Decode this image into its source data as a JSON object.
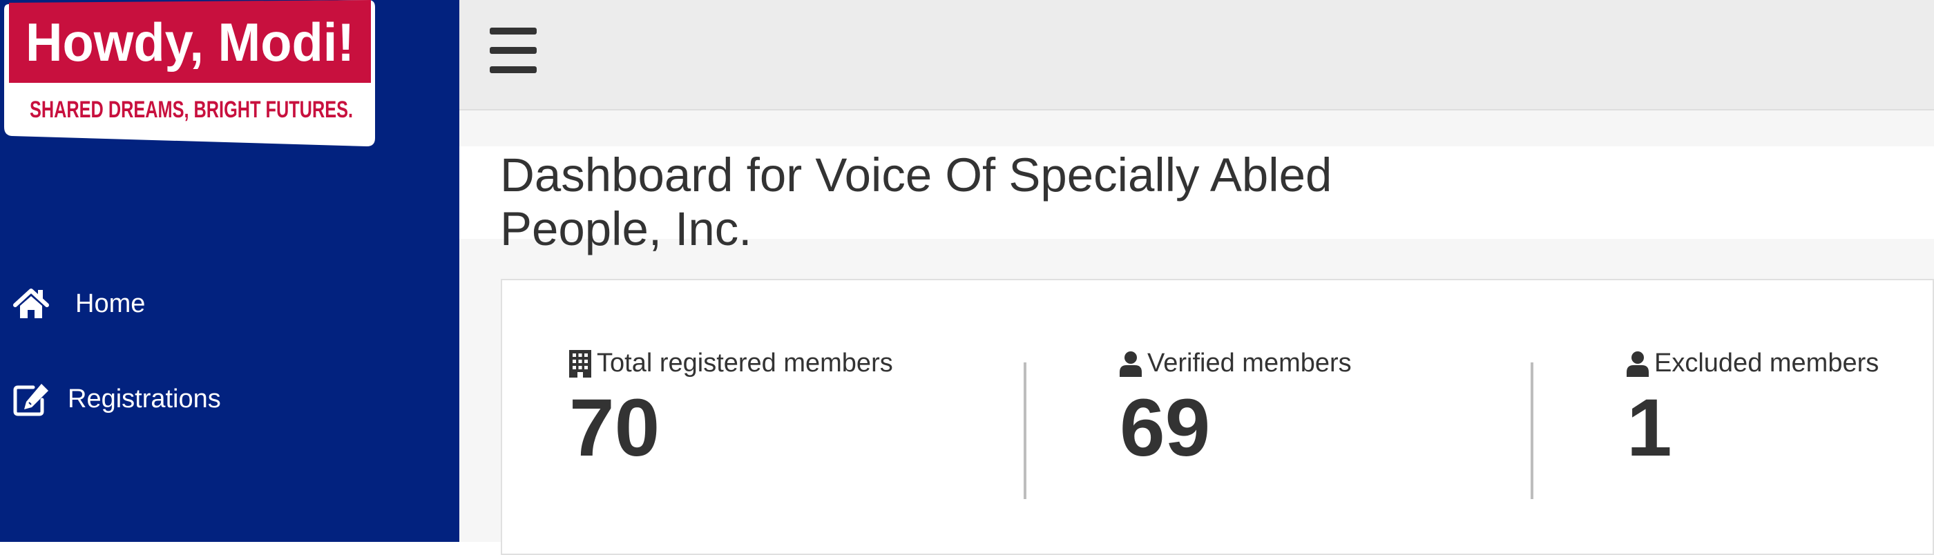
{
  "logo": {
    "title": "Howdy, Modi!",
    "tagline": "SHARED DREAMS, BRIGHT FUTURES."
  },
  "sidebar": {
    "items": [
      {
        "label": "Home",
        "icon": "home-icon"
      },
      {
        "label": "Registrations",
        "icon": "edit-icon"
      }
    ]
  },
  "header": {
    "menu_icon": "hamburger-menu-icon"
  },
  "page": {
    "title": "Dashboard for Voice Of Specially Abled People, Inc."
  },
  "stats": [
    {
      "label": "Total registered members",
      "value": "70",
      "icon": "building-icon"
    },
    {
      "label": "Verified members",
      "value": "69",
      "icon": "user-icon"
    },
    {
      "label": "Excluded members",
      "value": "1",
      "icon": "user-icon"
    }
  ],
  "colors": {
    "sidebar": "#02227f",
    "brand_red": "#c8103e",
    "topbar": "#ececec",
    "text": "#333333"
  }
}
